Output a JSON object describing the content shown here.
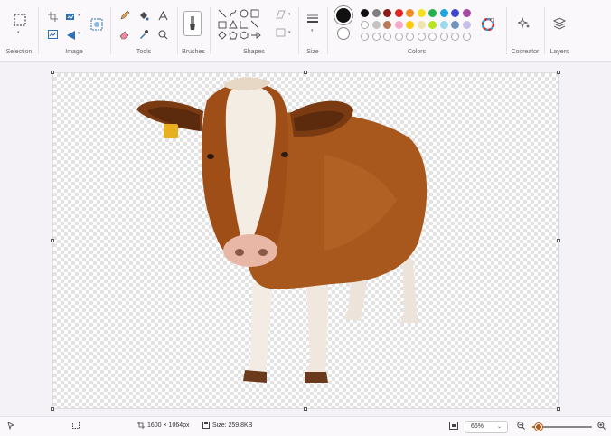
{
  "ribbon": {
    "groups": {
      "selection": "Selection",
      "image": "Image",
      "tools": "Tools",
      "brushes": "Brushes",
      "shapes": "Shapes",
      "size": "Size",
      "colors": "Colors",
      "cocreator": "Cocreator",
      "layers": "Layers"
    },
    "primary_color": "#111111",
    "secondary_color": "#ffffff",
    "palette_row1": [
      "#111111",
      "#7f7f7f",
      "#8b1a1a",
      "#e02424",
      "#f08a24",
      "#f5e020",
      "#22b14c",
      "#1fa3e0",
      "#3f48cc",
      "#a349a4"
    ],
    "palette_row2": [
      "#ffffff",
      "#c3c3c3",
      "#b97a57",
      "#f7a8c8",
      "#ffc90e",
      "#efe4b0",
      "#b5e61d",
      "#99d9ea",
      "#7092be",
      "#c8bfe7"
    ],
    "palette_row3_count": 10
  },
  "status": {
    "canvas_size": "1600 × 1064px",
    "file_size": "Size: 259.8KB",
    "zoom": "66%",
    "zoom_fraction": 0.1
  }
}
